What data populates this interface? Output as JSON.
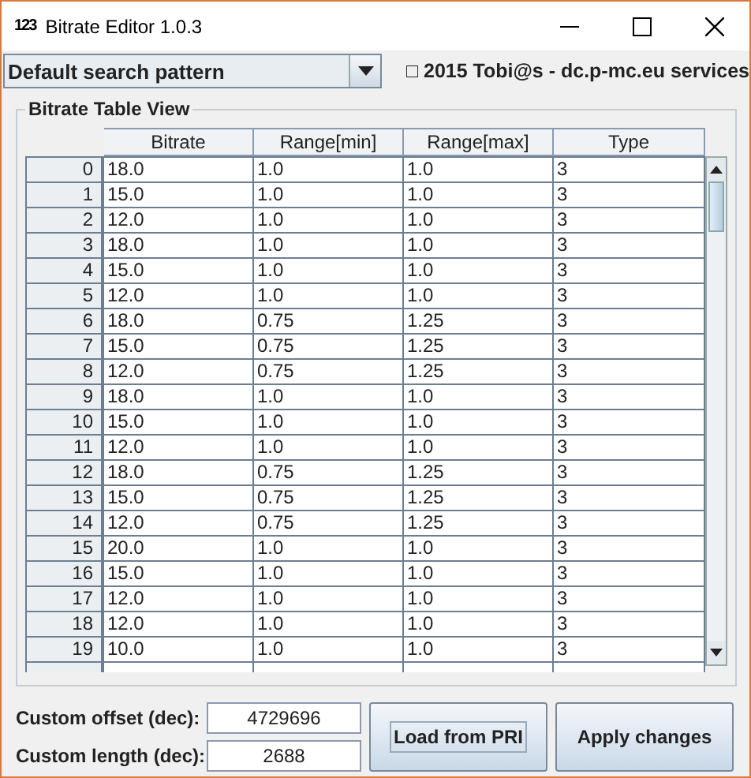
{
  "window": {
    "icon": "123",
    "title": "Bitrate Editor 1.0.3"
  },
  "pattern_select": {
    "value": "Default search pattern"
  },
  "copyright": "□ 2015 Tobi@s - dc.p-mc.eu services",
  "group": {
    "title": "Bitrate Table View"
  },
  "table": {
    "columns": [
      "Bitrate",
      "Range[min]",
      "Range[max]",
      "Type"
    ],
    "rows": [
      {
        "index": "0",
        "cells": [
          "18.0",
          "1.0",
          "1.0",
          "3"
        ]
      },
      {
        "index": "1",
        "cells": [
          "15.0",
          "1.0",
          "1.0",
          "3"
        ]
      },
      {
        "index": "2",
        "cells": [
          "12.0",
          "1.0",
          "1.0",
          "3"
        ]
      },
      {
        "index": "3",
        "cells": [
          "18.0",
          "1.0",
          "1.0",
          "3"
        ]
      },
      {
        "index": "4",
        "cells": [
          "15.0",
          "1.0",
          "1.0",
          "3"
        ]
      },
      {
        "index": "5",
        "cells": [
          "12.0",
          "1.0",
          "1.0",
          "3"
        ]
      },
      {
        "index": "6",
        "cells": [
          "18.0",
          "0.75",
          "1.25",
          "3"
        ]
      },
      {
        "index": "7",
        "cells": [
          "15.0",
          "0.75",
          "1.25",
          "3"
        ]
      },
      {
        "index": "8",
        "cells": [
          "12.0",
          "0.75",
          "1.25",
          "3"
        ]
      },
      {
        "index": "9",
        "cells": [
          "18.0",
          "1.0",
          "1.0",
          "3"
        ]
      },
      {
        "index": "10",
        "cells": [
          "15.0",
          "1.0",
          "1.0",
          "3"
        ]
      },
      {
        "index": "11",
        "cells": [
          "12.0",
          "1.0",
          "1.0",
          "3"
        ]
      },
      {
        "index": "12",
        "cells": [
          "18.0",
          "0.75",
          "1.25",
          "3"
        ]
      },
      {
        "index": "13",
        "cells": [
          "15.0",
          "0.75",
          "1.25",
          "3"
        ]
      },
      {
        "index": "14",
        "cells": [
          "12.0",
          "0.75",
          "1.25",
          "3"
        ]
      },
      {
        "index": "15",
        "cells": [
          "20.0",
          "1.0",
          "1.0",
          "3"
        ]
      },
      {
        "index": "16",
        "cells": [
          "15.0",
          "1.0",
          "1.0",
          "3"
        ]
      },
      {
        "index": "17",
        "cells": [
          "12.0",
          "1.0",
          "1.0",
          "3"
        ]
      },
      {
        "index": "18",
        "cells": [
          "12.0",
          "1.0",
          "1.0",
          "3"
        ]
      },
      {
        "index": "19",
        "cells": [
          "10.0",
          "1.0",
          "1.0",
          "3"
        ]
      }
    ]
  },
  "fields": [
    {
      "label": "Custom offset (dec):",
      "value": "4729696"
    },
    {
      "label": "Custom length (dec):",
      "value": "2688"
    }
  ],
  "buttons": [
    {
      "label": "Load from PRI",
      "focused": true
    },
    {
      "label": "Apply changes",
      "focused": false
    }
  ]
}
